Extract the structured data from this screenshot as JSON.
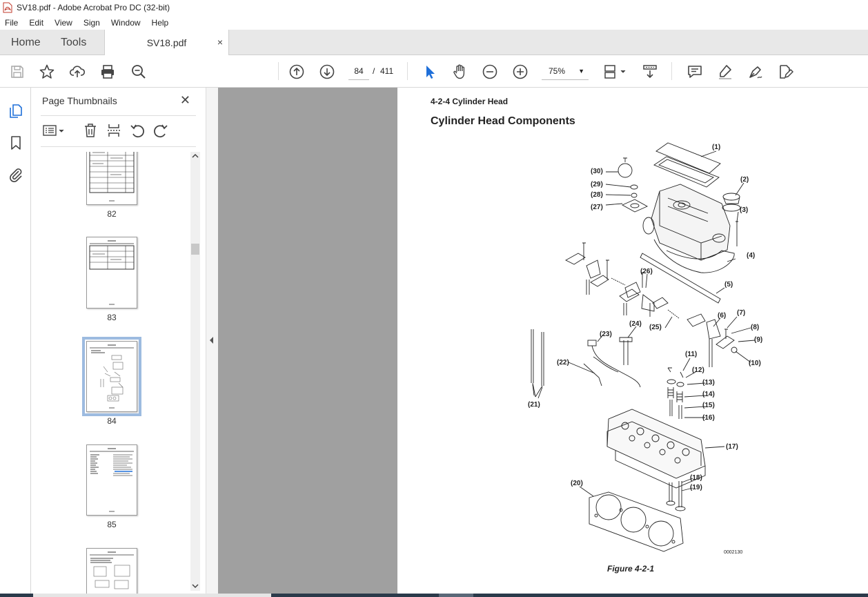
{
  "window": {
    "title": "SV18.pdf - Adobe Acrobat Pro DC (32-bit)"
  },
  "menu": [
    "File",
    "Edit",
    "View",
    "Sign",
    "Window",
    "Help"
  ],
  "tabs": {
    "home": "Home",
    "tools": "Tools",
    "document": "SV18.pdf",
    "close_glyph": "×"
  },
  "toolbar": {
    "current_page": "84",
    "page_separator": "/",
    "total_pages": "411",
    "zoom": "75%",
    "zoom_caret": "▼",
    "icons": [
      "save-icon",
      "star-icon",
      "upload-icon",
      "print-icon",
      "search-zoom-icon",
      "page-up-icon",
      "page-down-icon",
      "select-arrow-icon",
      "hand-icon",
      "zoom-out-icon",
      "zoom-in-icon",
      "page-display-icon",
      "scroll-mode-icon",
      "comment-icon",
      "highlight-icon",
      "sign-icon",
      "fill-sign-icon"
    ]
  },
  "thumbnail_panel": {
    "title": "Page Thumbnails",
    "close_glyph": "✕",
    "pages": [
      {
        "label": "82"
      },
      {
        "label": "83"
      },
      {
        "label": "84",
        "selected": true
      },
      {
        "label": "85"
      }
    ]
  },
  "document": {
    "section_title": "4-2-4  Cylinder Head",
    "heading": "Cylinder Head Components",
    "figure_code": "0002130",
    "figure_caption": "Figure 4-2-1",
    "callouts": [
      "(1)",
      "(2)",
      "(3)",
      "(4)",
      "(5)",
      "(6)",
      "(7)",
      "(8)",
      "(9)",
      "(10)",
      "(11)",
      "(12)",
      "(13)",
      "(14)",
      "(15)",
      "(16)",
      "(17)",
      "(18)",
      "(19)",
      "(20)",
      "(21)",
      "(22)",
      "(23)",
      "(24)",
      "(25)",
      "(26)",
      "(27)",
      "(28)",
      "(29)",
      "(30)"
    ]
  }
}
